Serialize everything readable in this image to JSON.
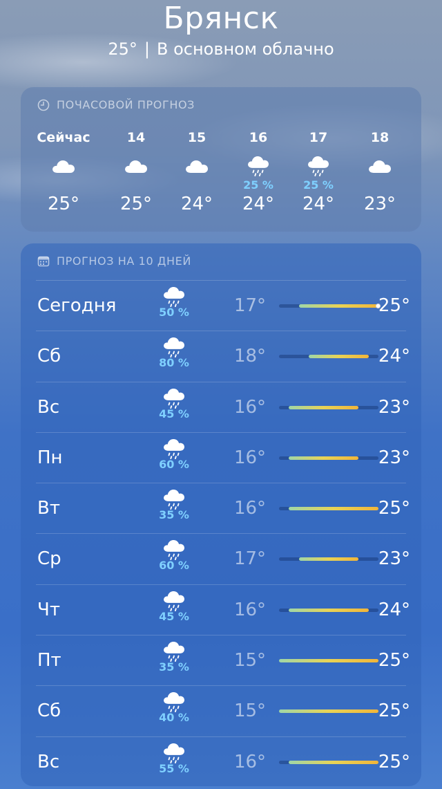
{
  "header": {
    "city": "Брянск",
    "current_temp": "25°",
    "separator": "|",
    "condition": "В основном облачно"
  },
  "hourly": {
    "title": "ПОЧАСОВОЙ ПРОГНОЗ",
    "icon": "clock-icon",
    "items": [
      {
        "time": "Сейчас",
        "icon": "cloud-icon",
        "pct": "",
        "temp": "25°"
      },
      {
        "time": "14",
        "icon": "cloud-icon",
        "pct": "",
        "temp": "25°"
      },
      {
        "time": "15",
        "icon": "cloud-icon",
        "pct": "",
        "temp": "24°"
      },
      {
        "time": "16",
        "icon": "cloud-rain-icon",
        "pct": "25 %",
        "temp": "24°"
      },
      {
        "time": "17",
        "icon": "cloud-rain-icon",
        "pct": "25 %",
        "temp": "24°"
      },
      {
        "time": "18",
        "icon": "cloud-icon",
        "pct": "",
        "temp": "23°"
      }
    ]
  },
  "daily": {
    "title": "ПРОГНОЗ НА 10 ДНЕЙ",
    "icon": "calendar-icon",
    "range_min": 15,
    "range_max": 25,
    "current_temp": 25,
    "days": [
      {
        "name": "Сегодня",
        "pct": "50 %",
        "lo": "17°",
        "hi": "25°",
        "lo_val": 17,
        "hi_val": 25,
        "icon": "cloud-rain-icon"
      },
      {
        "name": "Сб",
        "pct": "80 %",
        "lo": "18°",
        "hi": "24°",
        "lo_val": 18,
        "hi_val": 24,
        "icon": "cloud-rain-icon"
      },
      {
        "name": "Вс",
        "pct": "45 %",
        "lo": "16°",
        "hi": "23°",
        "lo_val": 16,
        "hi_val": 23,
        "icon": "cloud-rain-icon"
      },
      {
        "name": "Пн",
        "pct": "60 %",
        "lo": "16°",
        "hi": "23°",
        "lo_val": 16,
        "hi_val": 23,
        "icon": "cloud-rain-icon"
      },
      {
        "name": "Вт",
        "pct": "35 %",
        "lo": "16°",
        "hi": "25°",
        "lo_val": 16,
        "hi_val": 25,
        "icon": "cloud-rain-icon"
      },
      {
        "name": "Ср",
        "pct": "60 %",
        "lo": "17°",
        "hi": "23°",
        "lo_val": 17,
        "hi_val": 23,
        "icon": "cloud-rain-icon"
      },
      {
        "name": "Чт",
        "pct": "45 %",
        "lo": "16°",
        "hi": "24°",
        "lo_val": 16,
        "hi_val": 24,
        "icon": "cloud-rain-icon"
      },
      {
        "name": "Пт",
        "pct": "35 %",
        "lo": "15°",
        "hi": "25°",
        "lo_val": 15,
        "hi_val": 25,
        "icon": "cloud-rain-icon"
      },
      {
        "name": "Сб",
        "pct": "40 %",
        "lo": "15°",
        "hi": "25°",
        "lo_val": 15,
        "hi_val": 25,
        "icon": "cloud-rain-icon"
      },
      {
        "name": "Вс",
        "pct": "55 %",
        "lo": "16°",
        "hi": "25°",
        "lo_val": 16,
        "hi_val": 25,
        "icon": "cloud-rain-icon"
      }
    ]
  }
}
